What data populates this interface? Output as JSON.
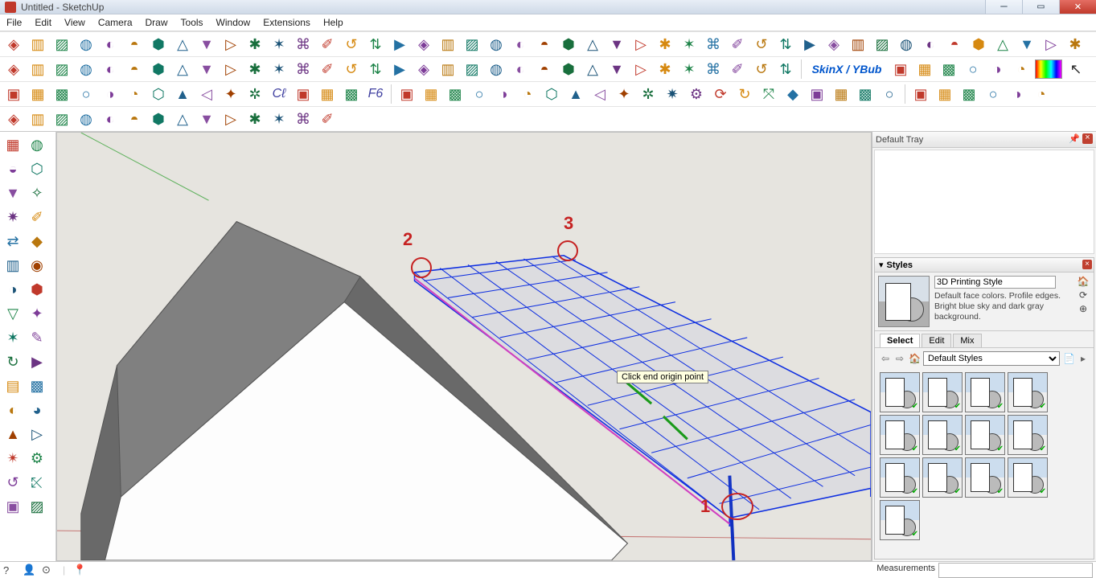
{
  "titlebar": {
    "text": "Untitled - SketchUp",
    "icon_name": "sketchup-icon"
  },
  "window_controls": {
    "minimize": "–",
    "maximize": "▭",
    "close": "✕"
  },
  "menu": {
    "items": [
      "File",
      "Edit",
      "View",
      "Camera",
      "Draw",
      "Tools",
      "Window",
      "Extensions",
      "Help"
    ]
  },
  "toolbars": {
    "row1_icons": [
      "select",
      "tag",
      "plane",
      "plane",
      "plane",
      "plane",
      "cube1",
      "cube2",
      "3box",
      "panel",
      "split",
      "flag",
      "box3d",
      "extrude",
      "crate",
      "bolt",
      "dot",
      "plus",
      "plus2",
      "puzzle",
      "puzzle2",
      "drop",
      "drop2",
      "triangle",
      "orbit",
      "orbit2",
      "pan",
      "swirl",
      "swirl2",
      "star",
      "compass",
      "undo",
      "chk",
      "square",
      "block",
      "link",
      "shelves",
      "shelves2",
      "sandbox",
      "sandbox2",
      "sandbox3",
      "drape",
      "tri-red",
      "rect",
      "dotted"
    ],
    "row2_icons": [
      "arc",
      "arcs",
      "wave",
      "wave2",
      "zig",
      "bez",
      "bez2",
      "rect",
      "rrect",
      "oval",
      "rgn",
      "paren",
      "arc3",
      "arc4",
      "vline",
      "n",
      "circle",
      "wrench",
      "oshape",
      "q",
      "img",
      "imgs",
      "sun",
      "bulb",
      "lamp",
      "eye",
      "person",
      "gear",
      "tree",
      "grass",
      "bush",
      "bush2",
      "bush3"
    ],
    "row2_skin_label": "SkinX / YBub",
    "row2_extras": [
      "s1",
      "s2",
      "s3",
      "play",
      "stop",
      "help"
    ],
    "row2_colorbar": "color-swatch",
    "row2_arrow": "pointer",
    "row3_icons_a": [
      "mat",
      "panels",
      "align",
      "align",
      "align",
      "diag",
      "mirror",
      "mirror2",
      "rot1",
      "rot2",
      "paper"
    ],
    "row3_cl": "Cℓ",
    "row3_icons_b": [
      "box",
      "box2",
      "box3"
    ],
    "row3_f6": "F6",
    "row3_icons_c": [
      "eraser",
      "dot",
      "grid1",
      "grid2",
      "grid3",
      "grid4",
      "grid5",
      "grid6",
      "grid7",
      "star",
      "hash",
      "la",
      "lb",
      "lc",
      "ld",
      "le",
      "lf",
      "lg",
      "comp",
      "comp2",
      "comp3"
    ],
    "row3_icons_d": [
      "shell",
      "globe",
      "shield",
      "cube-r",
      "cube-b",
      "cube-g"
    ],
    "row4_icons": [
      "road",
      "aj",
      "ar",
      "av",
      "an",
      "ax",
      "af",
      "arch",
      "arch2",
      "arcb",
      "half",
      "half2",
      "x-g",
      "x-y"
    ]
  },
  "left_tools": [
    "select",
    "cube",
    "bucket",
    "eraser",
    "pencil",
    "scribble",
    "rect",
    "arc",
    "pie",
    "arc2",
    "curve",
    "curve2",
    "square",
    "arc3",
    "move",
    "follow",
    "rotate",
    "extrude",
    "scale",
    "offset",
    "tape",
    "axis",
    "protractor",
    "dim",
    "text",
    "text3d",
    "orbit",
    "pan",
    "zoom",
    "zoom-ext",
    "hand",
    "walk"
  ],
  "viewport": {
    "tooltip": "Click end origin point",
    "annotations": {
      "p1": "1",
      "p2": "2",
      "p3": "3"
    }
  },
  "tray": {
    "header": "Default Tray",
    "pin_glyph": "📌",
    "close_glyph": "×"
  },
  "styles_panel": {
    "title": "Styles",
    "collapse_glyph": "▾",
    "close_glyph": "×",
    "style_name": "3D Printing Style",
    "style_desc": "Default face colors. Profile edges. Bright blue sky and dark gray background.",
    "side_buttons": [
      "🏠",
      "⟳",
      "⊕"
    ],
    "tabs": [
      "Select",
      "Edit",
      "Mix"
    ],
    "nav": {
      "back": "⇦",
      "fwd": "⇨",
      "home": "🏠",
      "dropdown": "Default Styles",
      "detail": "📄",
      "menu": "▸"
    },
    "thumbs_count": 13
  },
  "status": {
    "icons": [
      "?",
      "👤",
      "⊙",
      "📍"
    ],
    "sep": "|",
    "measurements_label": "Measurements"
  }
}
